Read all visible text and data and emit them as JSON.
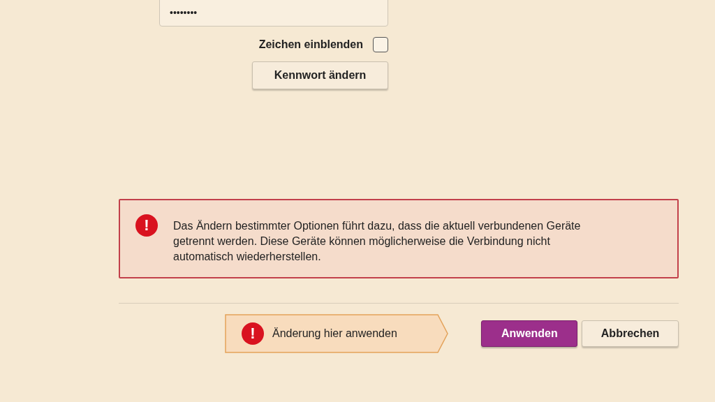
{
  "password": {
    "value": "••••••••"
  },
  "show_chars": {
    "label": "Zeichen einblenden",
    "checked": false
  },
  "change_button": "Kennwort ändern",
  "alert": {
    "text": "Das Ändern bestimmter Optionen führt dazu, dass die aktuell verbundenen Geräte getrennt werden. Diese Geräte können möglicherweise die Verbindung nicht automatisch wiederherstellen.",
    "icon": "!"
  },
  "hint": {
    "text": "Änderung hier anwenden",
    "icon": "!"
  },
  "buttons": [
    {
      "label": "Anwenden",
      "kind": "primary"
    },
    {
      "label": "Abbrechen",
      "kind": "secondary"
    }
  ]
}
